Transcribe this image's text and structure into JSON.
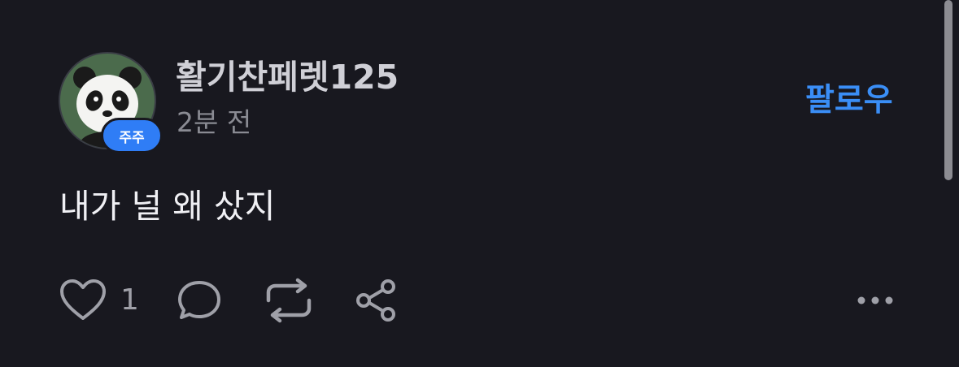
{
  "post": {
    "author": {
      "username": "활기찬페렛125",
      "holder_badge": "주주",
      "avatar_icon": "panda-avatar"
    },
    "timestamp": "2분 전",
    "follow_label": "팔로우",
    "body": "내가 널 왜 샀지",
    "actions": {
      "like_icon": "heart-icon",
      "like_count": "1",
      "comment_icon": "comment-icon",
      "repost_icon": "repost-icon",
      "share_icon": "share-icon",
      "more_icon": "more-icon"
    }
  },
  "colors": {
    "background": "#18181f",
    "accent": "#3a8ef6",
    "badge": "#2f7df6",
    "text_primary": "#f0f0f4",
    "text_secondary": "#8a8b93",
    "icon": "#9fa0a8"
  }
}
